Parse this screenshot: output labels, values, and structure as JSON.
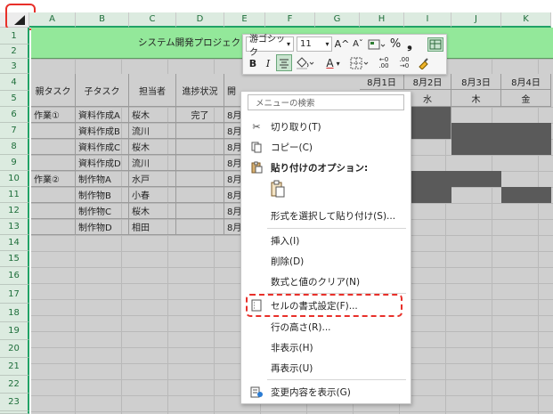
{
  "sheet": {
    "columns": [
      "A",
      "B",
      "C",
      "D",
      "E",
      "F",
      "G",
      "H",
      "I",
      "J",
      "K"
    ],
    "rows": [
      "1",
      "2",
      "3",
      "4",
      "5",
      "6",
      "7",
      "8",
      "9",
      "10",
      "11",
      "12",
      "13",
      "14",
      "15",
      "16",
      "17",
      "18",
      "19",
      "20",
      "21",
      "22",
      "23",
      "24"
    ],
    "title": "システム開発プロジェク",
    "headers": {
      "parent_task": "親タスク",
      "child_task": "子タスク",
      "assignee": "担当者",
      "status": "進捗状況",
      "start_partial": "開"
    },
    "dates": [
      "8月1日",
      "8月2日",
      "8月3日",
      "8月4日"
    ],
    "weekdays": [
      "水",
      "木",
      "金"
    ],
    "tasks": [
      {
        "parent": "作業①",
        "child": "資料作成A",
        "assignee": "桜木",
        "status": "完了",
        "start": "8月"
      },
      {
        "parent": "",
        "child": "資料作成B",
        "assignee": "流川",
        "status": "",
        "start": "8月"
      },
      {
        "parent": "",
        "child": "資料作成C",
        "assignee": "桜木",
        "status": "",
        "start": "8月"
      },
      {
        "parent": "",
        "child": "資料作成D",
        "assignee": "流川",
        "status": "",
        "start": "8月"
      },
      {
        "parent": "作業②",
        "child": "制作物A",
        "assignee": "水戸",
        "status": "",
        "start": "8月"
      },
      {
        "parent": "",
        "child": "制作物B",
        "assignee": "小春",
        "status": "",
        "start": "8月"
      },
      {
        "parent": "",
        "child": "制作物C",
        "assignee": "桜木",
        "status": "",
        "start": "8月"
      },
      {
        "parent": "",
        "child": "制作物D",
        "assignee": "相田",
        "status": "",
        "start": "8月"
      }
    ]
  },
  "mini_toolbar": {
    "font_name": "游ゴシック",
    "font_size": "11",
    "grow_font": "A^",
    "shrink_font": "Aˇ",
    "percent": "%",
    "comma": "❟",
    "bold": "B",
    "italic": "I",
    "font_color_letter": "A",
    "inc_decimal": "←0 .00",
    "dec_decimal": ".00 →0"
  },
  "context_menu": {
    "search_placeholder": "メニューの検索",
    "items": {
      "cut": "切り取り(T)",
      "copy": "コピー(C)",
      "paste_options": "貼り付けのオプション:",
      "paste_special": "形式を選択して貼り付け(S)...",
      "insert": "挿入(I)",
      "delete": "削除(D)",
      "clear_contents": "数式と値のクリア(N)",
      "format_cells": "セルの書式設定(F)...",
      "row_height": "行の高さ(R)...",
      "hide": "非表示(H)",
      "unhide": "再表示(U)",
      "show_changes": "変更内容を表示(G)"
    }
  },
  "colors": {
    "accent_green": "#21a366",
    "title_band": "#93e89a",
    "highlight_red": "#e8302a",
    "gantt_fill": "#5a5a5a"
  }
}
